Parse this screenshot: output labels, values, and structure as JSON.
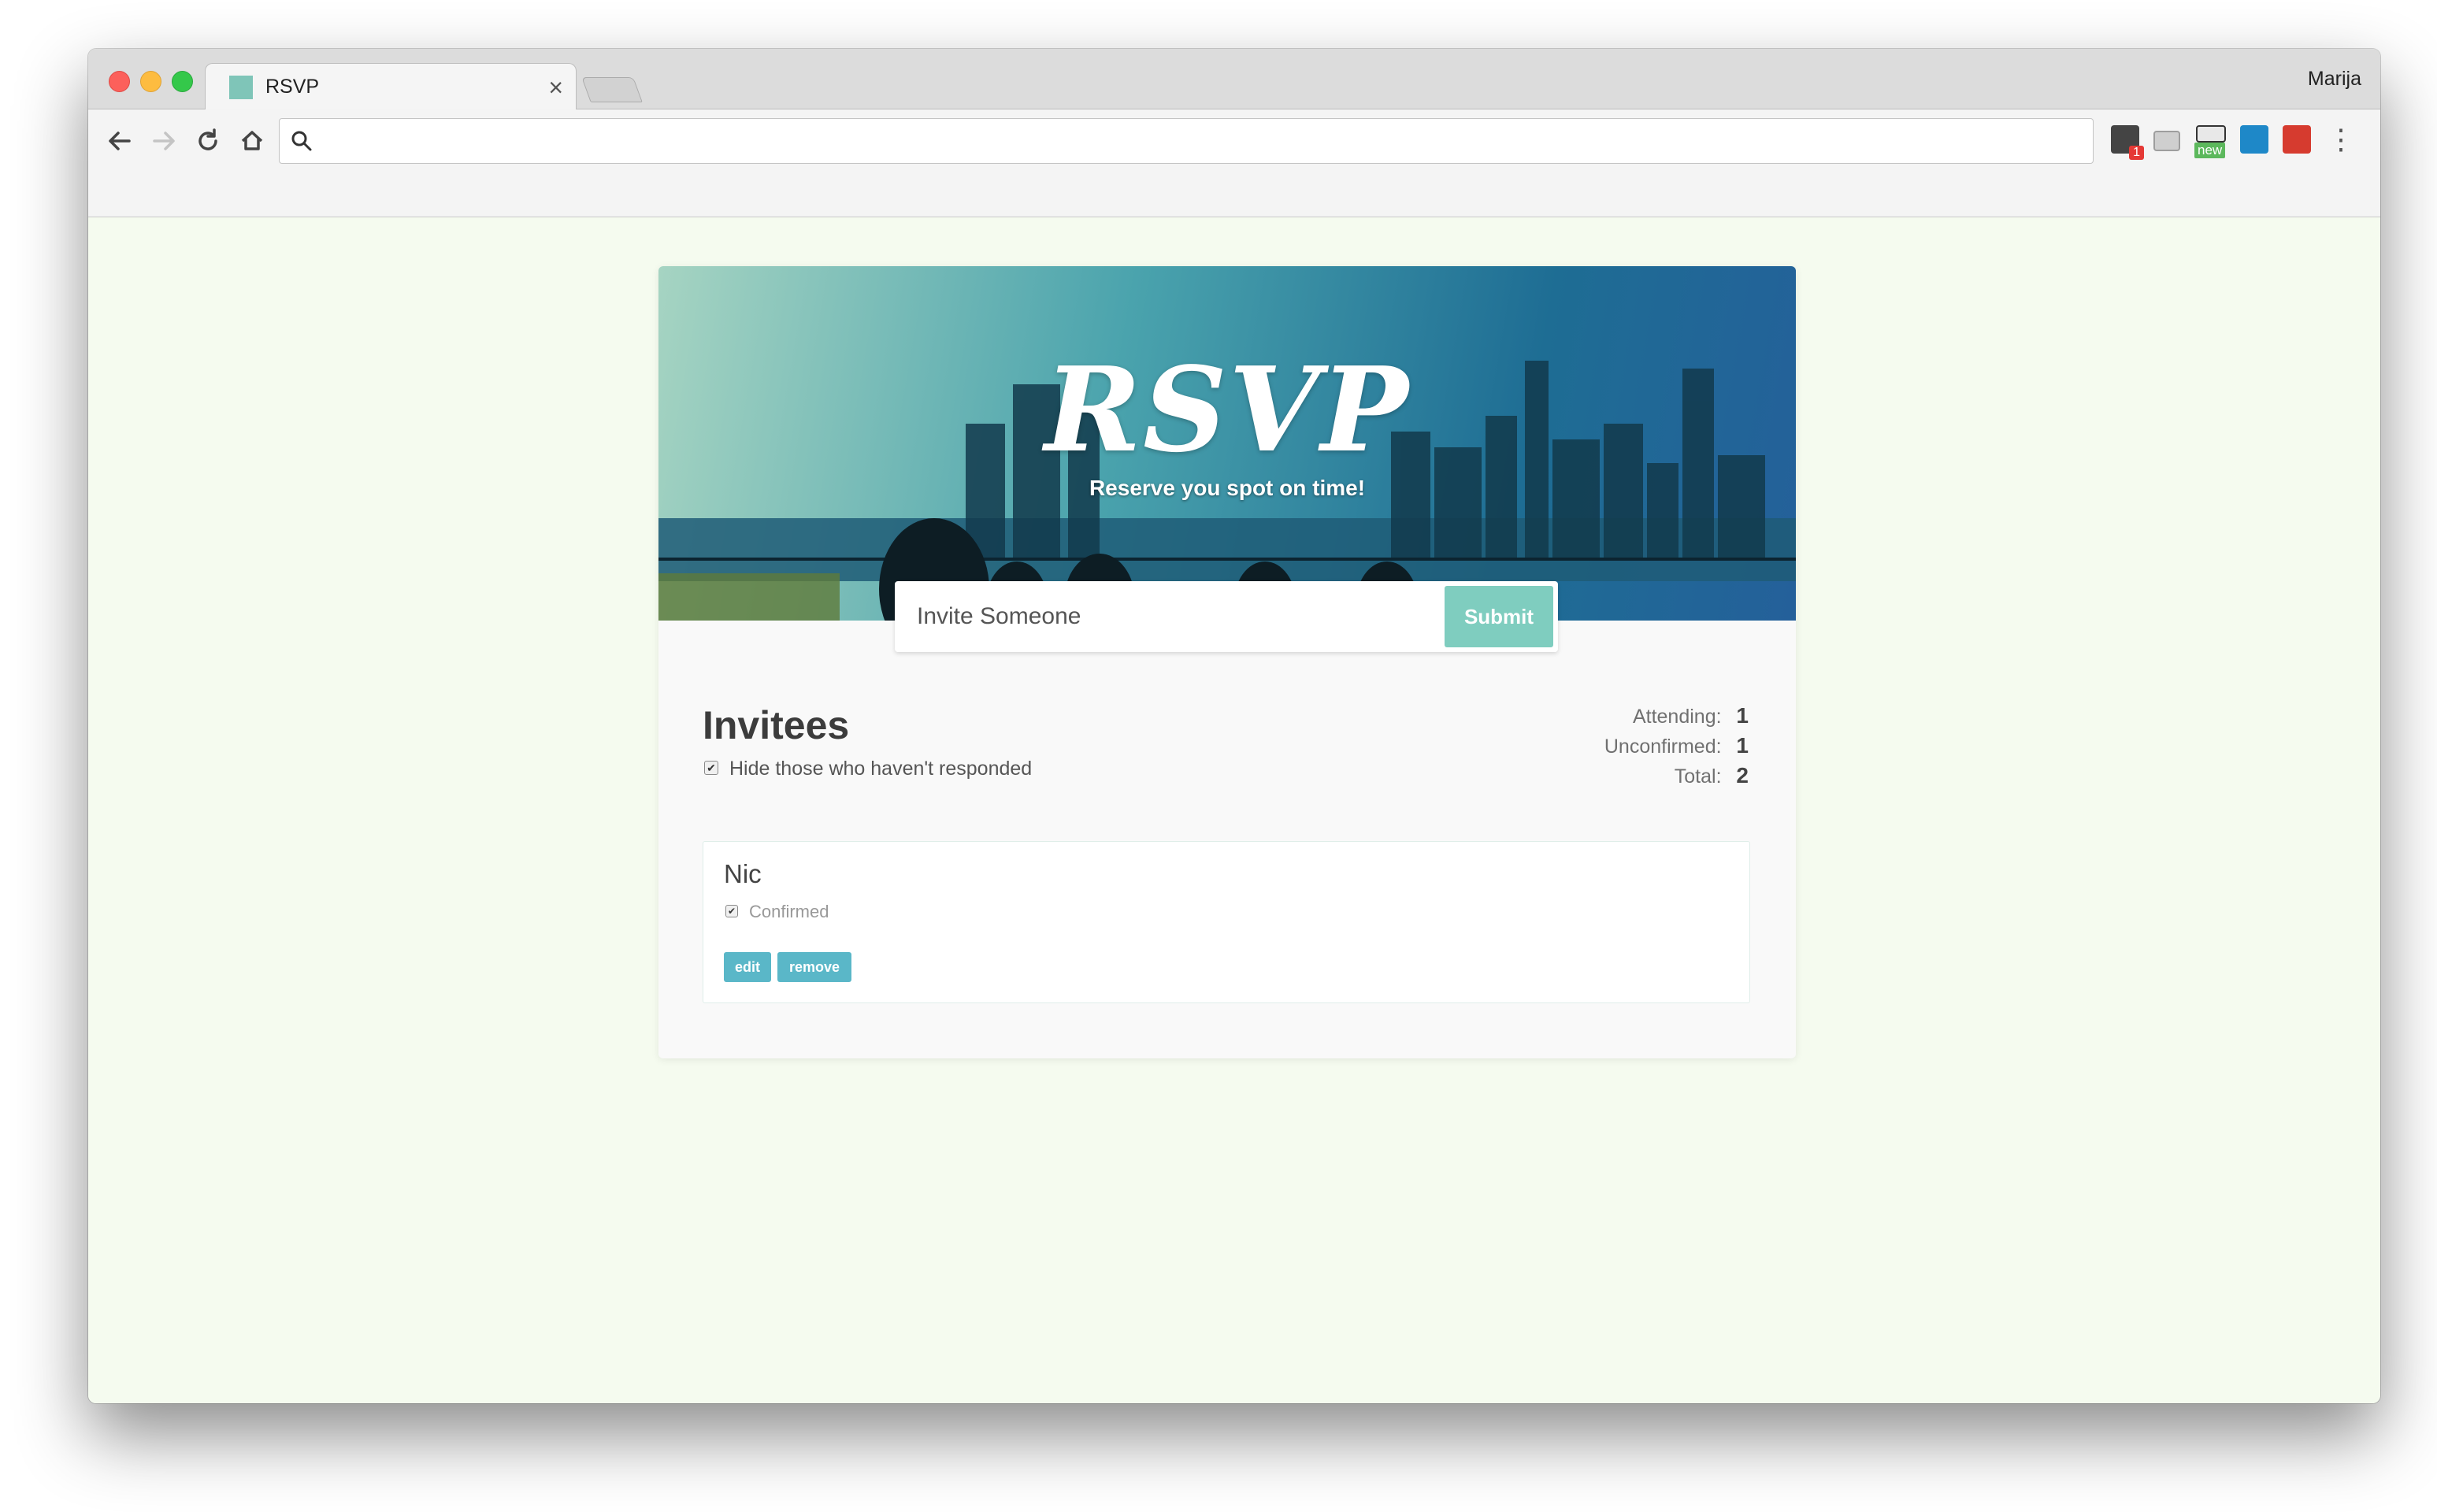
{
  "browser": {
    "tab_title": "RSVP",
    "tab_close": "×",
    "profile_name": "Marija",
    "extension_badge": "1",
    "extension_new_label": "new",
    "omnibox_value": ""
  },
  "hero": {
    "title": "RSVP",
    "subtitle": "Reserve you spot on time!"
  },
  "invite_form": {
    "placeholder": "Invite Someone",
    "submit_label": "Submit"
  },
  "invitees": {
    "title": "Invitees",
    "hide_label": "Hide those who haven't responded",
    "hide_checked": true
  },
  "counts": [
    {
      "label": "Attending:",
      "value": "1"
    },
    {
      "label": "Unconfirmed:",
      "value": "1"
    },
    {
      "label": "Total:",
      "value": "2"
    }
  ],
  "guests": [
    {
      "name": "Nic",
      "status_label": "Confirmed",
      "confirmed": true,
      "edit_label": "edit",
      "remove_label": "remove"
    }
  ],
  "colors": {
    "page_background": "#f5fbef",
    "submit_button": "#7fcdbf",
    "tag_button": "#5ab7c8",
    "tab_favicon": "#7fc5b8"
  }
}
